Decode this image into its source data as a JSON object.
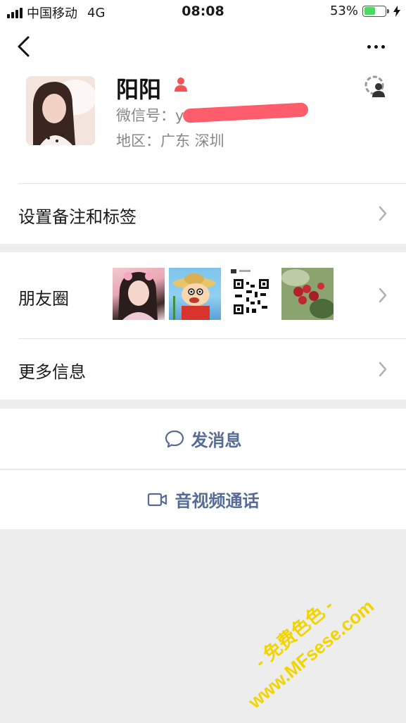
{
  "status_bar": {
    "carrier": "中国移动",
    "network": "4G",
    "time": "08:08",
    "battery_percent": "53%",
    "battery_level": 0.53
  },
  "profile": {
    "name": "阳阳",
    "wechat_id_label": "微信号：",
    "wechat_id_value": "y",
    "region_label": "地区：",
    "region_value": "广东 深圳"
  },
  "rows": {
    "set_remark": "设置备注和标签",
    "moments": "朋友圈",
    "more_info": "更多信息"
  },
  "actions": {
    "send_message": "发消息",
    "video_call": "音视频通话"
  },
  "watermark": {
    "line1": "- 免费色色 -",
    "line2": "www.MFsese.com"
  },
  "colors": {
    "link": "#576b95",
    "background": "#ededed",
    "gender_female": "#fa5151",
    "battery": "#4cd964",
    "watermark": "#f1d400"
  }
}
